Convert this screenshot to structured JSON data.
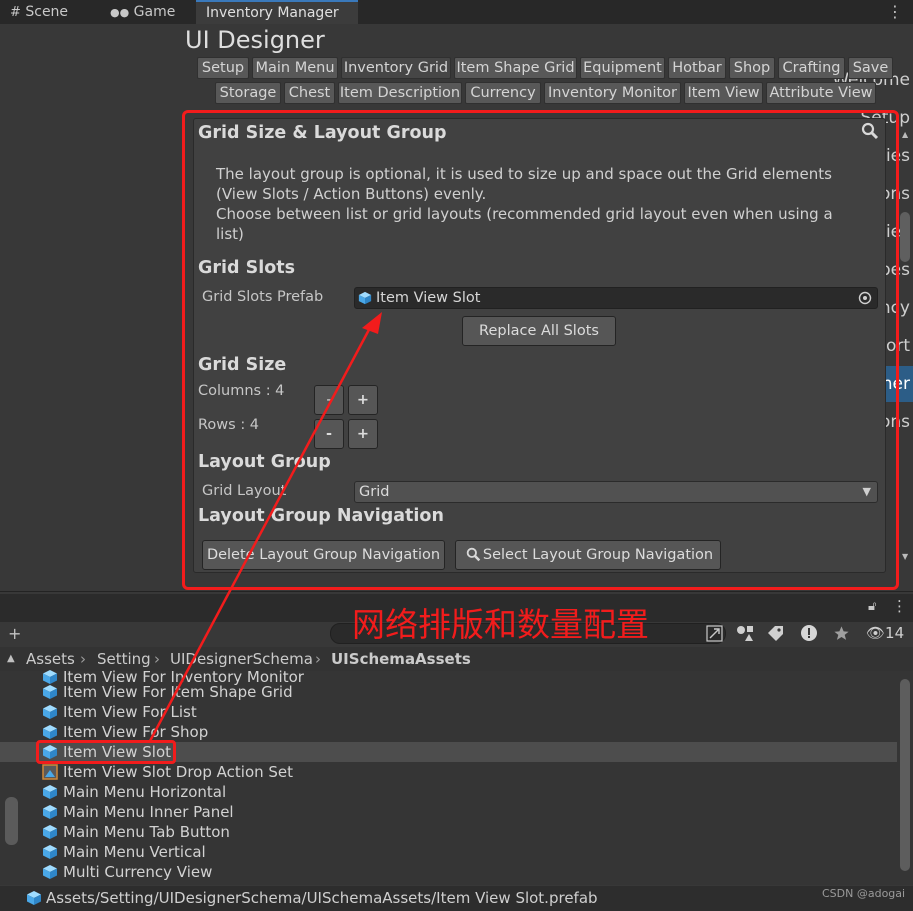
{
  "top_tabs": [
    {
      "label": "Scene",
      "icon": "grid-icon"
    },
    {
      "label": "Game",
      "icon": "gamepad-icon"
    },
    {
      "label": "Inventory Manager",
      "active": true
    }
  ],
  "nav": {
    "items": [
      "Welcome",
      "Setup",
      "Item Categories",
      "Item Definitions",
      "Crafting Categories",
      "Crafting Recipes",
      "Currency",
      "Import/Export",
      "UI Designer",
      "Integrations"
    ],
    "selected": "UI Designer"
  },
  "designer": {
    "title": "UI Designer",
    "tabs_row1": [
      "Setup",
      "Main Menu",
      "Inventory Grid",
      "Item Shape Grid",
      "Equipment",
      "Hotbar",
      "Shop",
      "Crafting",
      "Save"
    ],
    "tabs_row2": [
      "Storage",
      "Chest",
      "Item Description",
      "Currency",
      "Inventory Monitor",
      "Item View",
      "Attribute View"
    ],
    "selected_tab": "Inventory Grid"
  },
  "panel": {
    "header": "Grid Size & Layout Group",
    "description_line1": "The layout group is optional, it is used to size up and space out the Grid elements",
    "description_line2": "(View Slots / Action Buttons) evenly.",
    "description_line3": "Choose between list or grid layouts (recommended grid layout even when using a",
    "description_line4": "list)",
    "grid_slots_header": "Grid Slots",
    "grid_slots_prefab_label": "Grid Slots Prefab",
    "grid_slots_prefab_value": "Item View Slot",
    "replace_all_slots": "Replace All Slots",
    "grid_size_header": "Grid Size",
    "columns_label": "Columns : 4",
    "rows_label": "Rows : 4",
    "minus": "-",
    "plus": "+",
    "layout_group_header": "Layout Group",
    "grid_layout_label": "Grid Layout",
    "grid_layout_value": "Grid",
    "layout_nav_header": "Layout Group Navigation",
    "delete_nav_button": "Delete Layout Group Navigation",
    "select_nav_button": "Select Layout Group Navigation"
  },
  "annotation": "网络排版和数量配置",
  "project": {
    "hidden_count": "14",
    "breadcrumb": [
      "Assets",
      "Setting",
      "UIDesignerSchema",
      "UISchemaAssets"
    ],
    "assets": [
      {
        "name": "Item View For Inventory Monitor",
        "icon": "prefab-cube-icon"
      },
      {
        "name": "Item View For Item Shape Grid",
        "icon": "prefab-cube-icon"
      },
      {
        "name": "Item View For List",
        "icon": "prefab-cube-icon"
      },
      {
        "name": "Item View For Shop",
        "icon": "prefab-cube-icon"
      },
      {
        "name": "Item View Slot",
        "icon": "prefab-cube-icon",
        "selected": true
      },
      {
        "name": "Item View Slot Drop Action Set",
        "icon": "scriptable-object-icon"
      },
      {
        "name": "Main Menu Horizontal",
        "icon": "prefab-cube-icon"
      },
      {
        "name": "Main Menu Inner Panel",
        "icon": "prefab-cube-icon"
      },
      {
        "name": "Main Menu Tab Button",
        "icon": "prefab-cube-icon"
      },
      {
        "name": "Main Menu Vertical",
        "icon": "prefab-cube-icon"
      },
      {
        "name": "Multi Currency View",
        "icon": "prefab-cube-icon"
      }
    ],
    "status_path": "Assets/Setting/UIDesignerSchema/UISchemaAssets/Item View Slot.prefab"
  },
  "watermark": "CSDN @adogai",
  "colors": {
    "highlight": "#f21c1c",
    "selection": "#2c5d87",
    "prefab_blue": "#5fb8f2"
  }
}
